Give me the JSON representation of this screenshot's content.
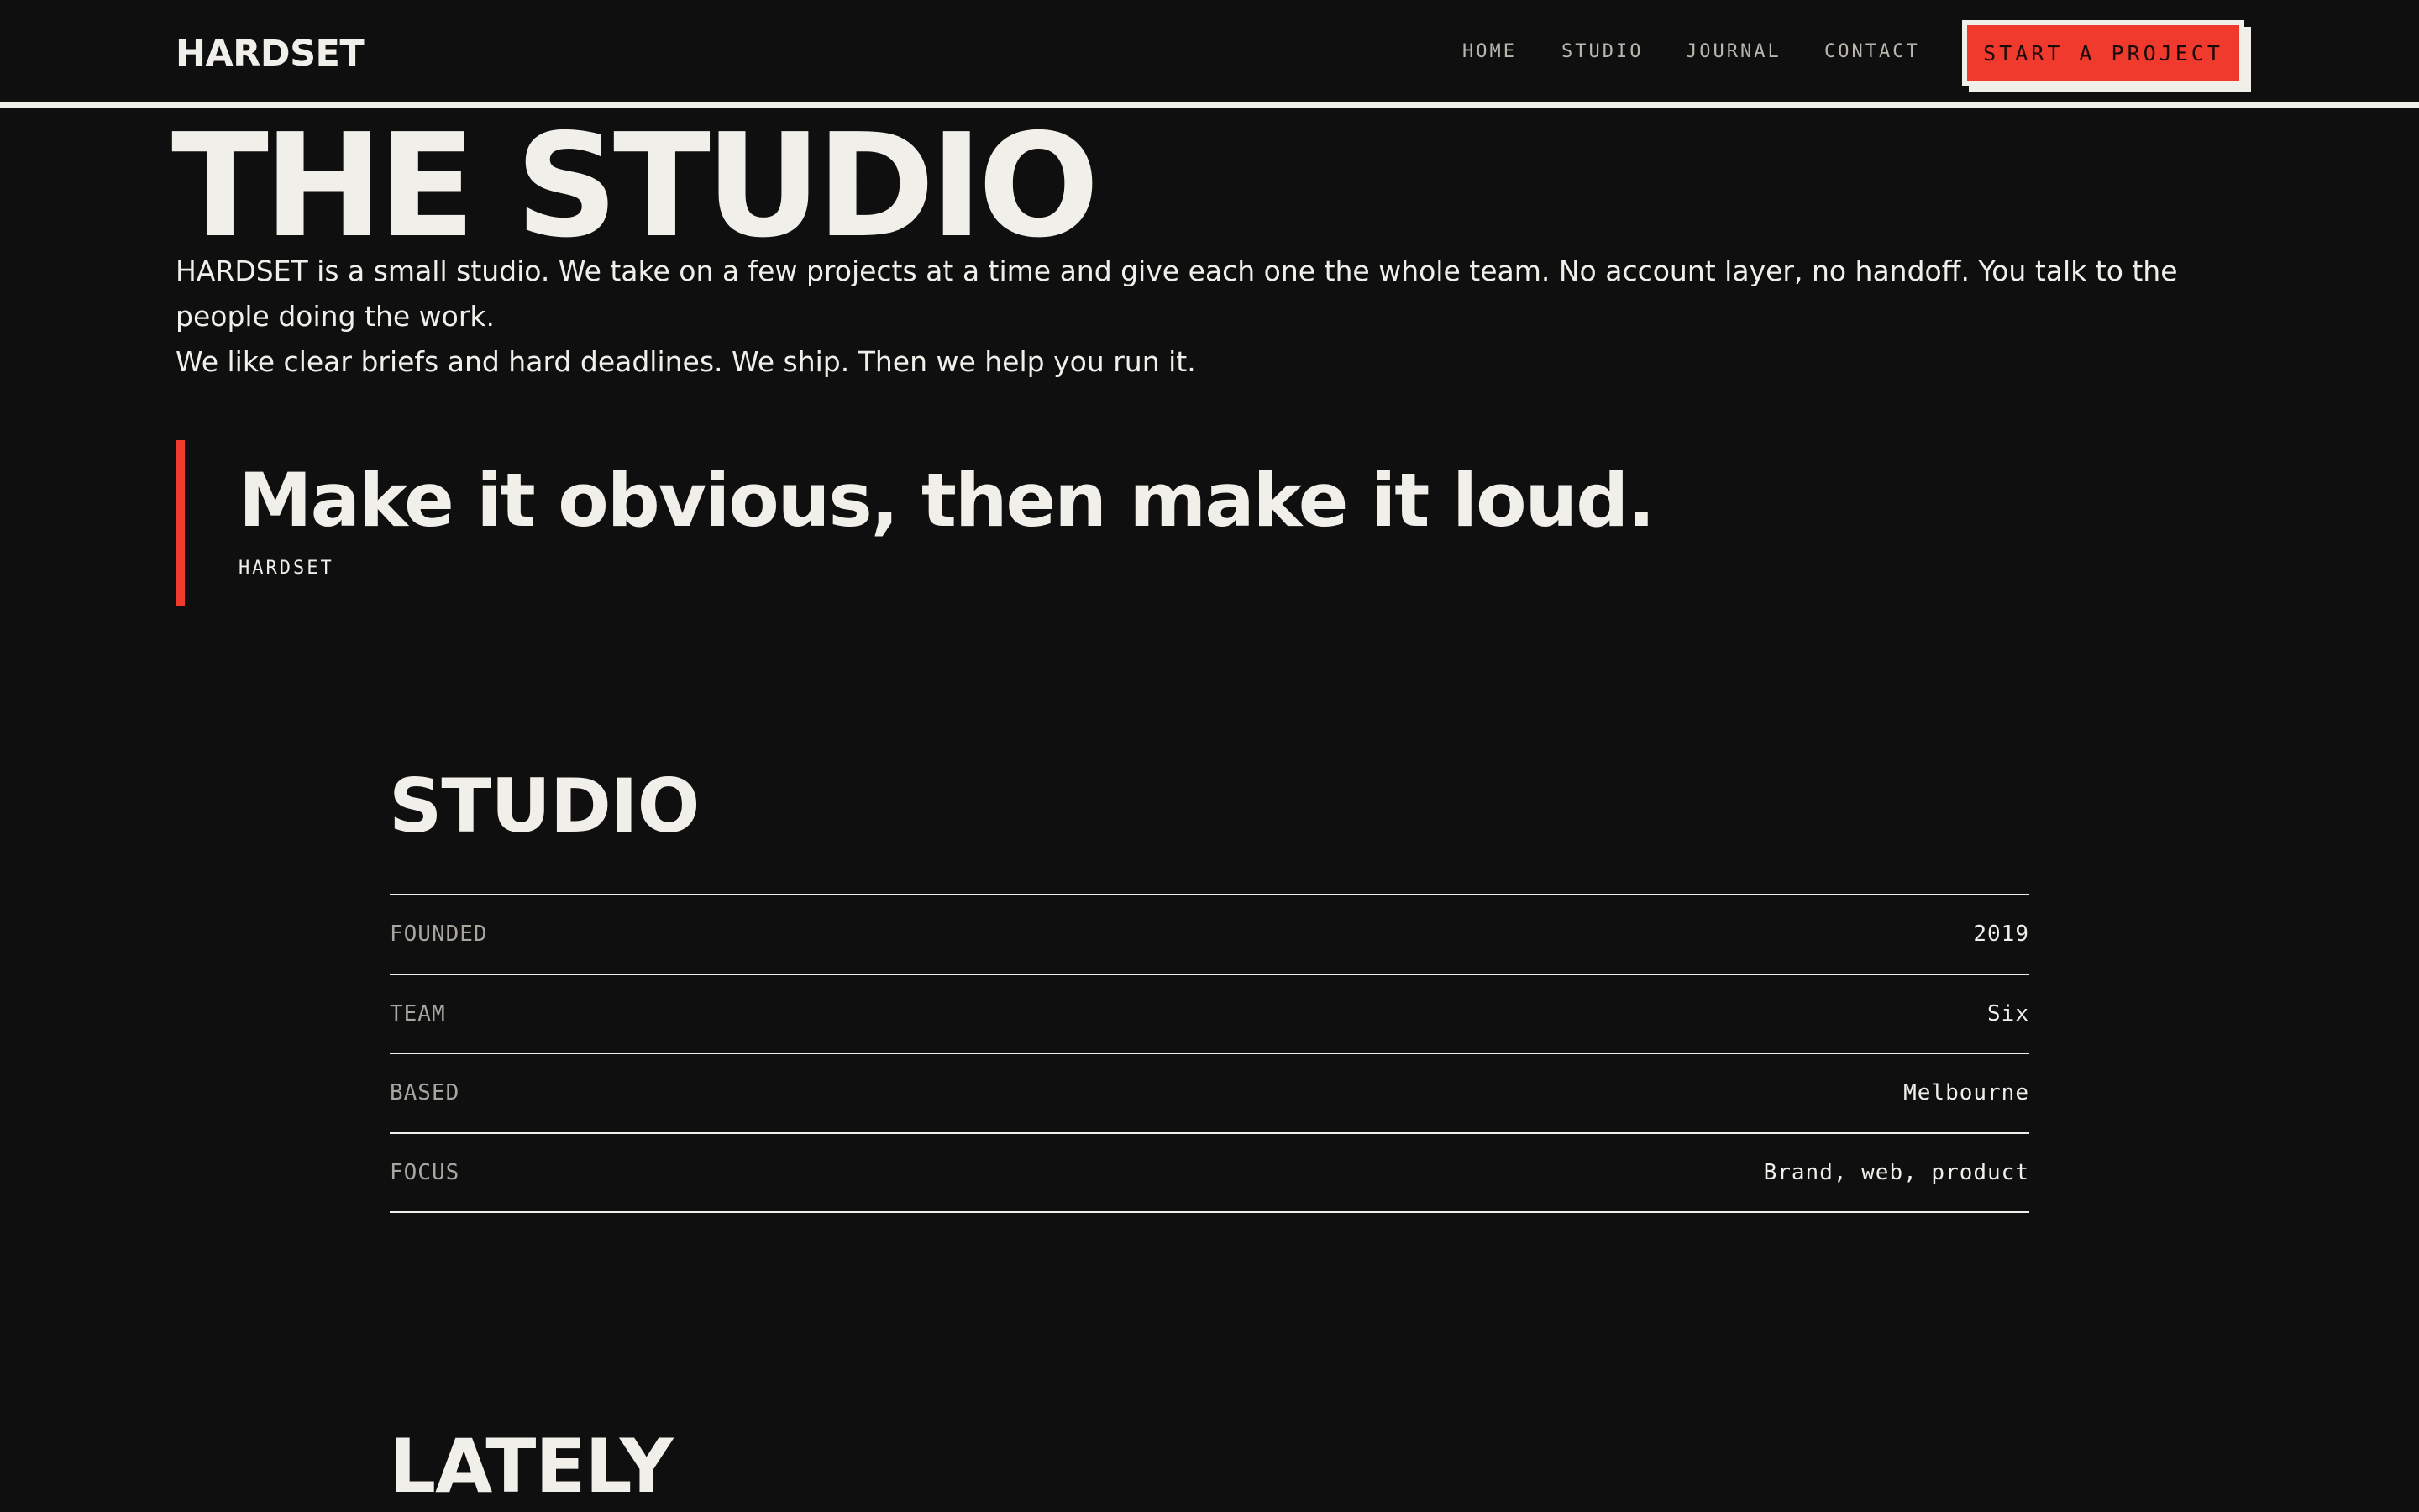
{
  "header": {
    "logo": "HARDSET",
    "nav": [
      {
        "label": "HOME"
      },
      {
        "label": "STUDIO"
      },
      {
        "label": "JOURNAL"
      },
      {
        "label": "CONTACT"
      }
    ],
    "cta_label": "START A PROJECT"
  },
  "hero": {
    "title": "THE STUDIO",
    "intro_1": "HARDSET is a small studio. We take on a few projects at a time and give each one the whole team. No account layer, no handoff. You talk to the people doing the work.",
    "intro_2": "We like clear briefs and hard deadlines. We ship. Then we help you run it."
  },
  "quote": {
    "text": "Make it obvious, then make it loud.",
    "cite": "HARDSET"
  },
  "studio": {
    "title": "STUDIO",
    "facts": [
      {
        "label": "FOUNDED",
        "value": "2019"
      },
      {
        "label": "TEAM",
        "value": "Six"
      },
      {
        "label": "BASED",
        "value": "Melbourne"
      },
      {
        "label": "FOCUS",
        "value": "Brand, web, product"
      }
    ]
  },
  "lately": {
    "title": "LATELY"
  },
  "colors": {
    "background": "#0f0f0f",
    "foreground": "#f1efe9",
    "accent": "#f03a2e",
    "muted": "#a9a69f"
  }
}
